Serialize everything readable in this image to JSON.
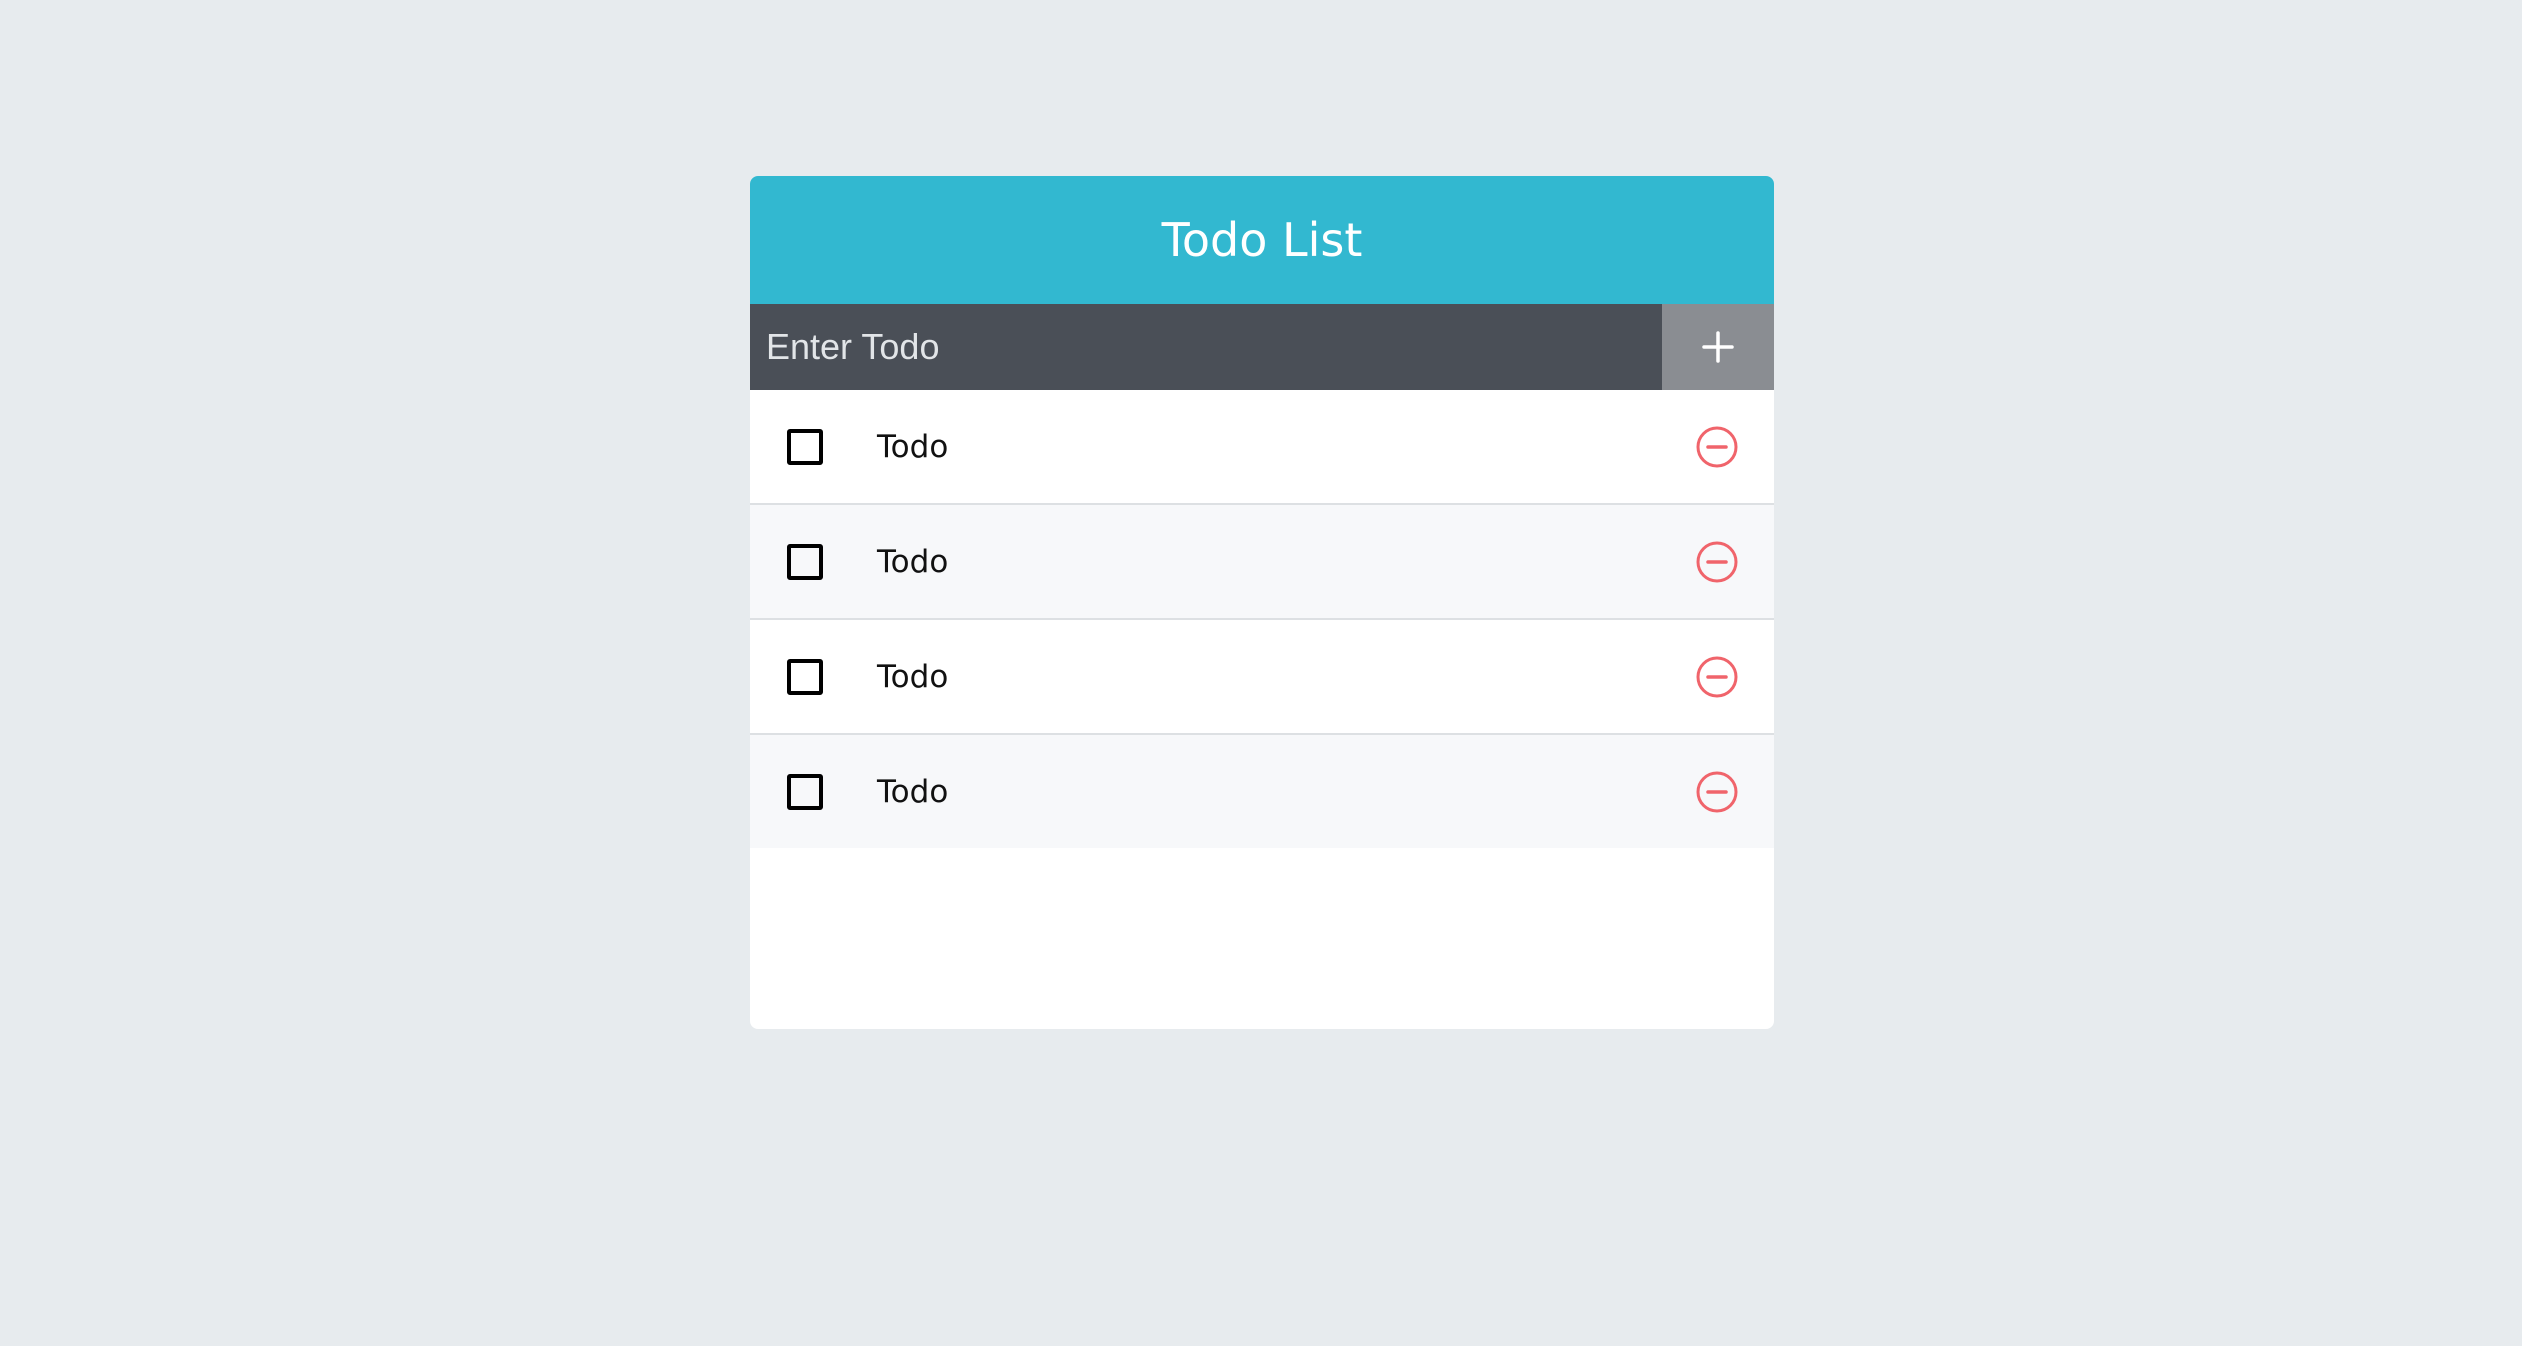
{
  "header": {
    "title": "Todo List"
  },
  "input": {
    "placeholder": "Enter Todo",
    "value": ""
  },
  "add_button": {
    "icon": "plus-icon"
  },
  "todos": [
    {
      "text": "Todo",
      "done": false
    },
    {
      "text": "Todo",
      "done": false
    },
    {
      "text": "Todo",
      "done": false
    },
    {
      "text": "Todo",
      "done": false
    }
  ],
  "colors": {
    "page_background": "#e7ebee",
    "header_background": "#32b8d0",
    "input_background": "#4a4f57",
    "add_button_background": "#8a8d92",
    "remove_icon": "#f0646b",
    "row_alt_background": "#f7f8fa"
  }
}
